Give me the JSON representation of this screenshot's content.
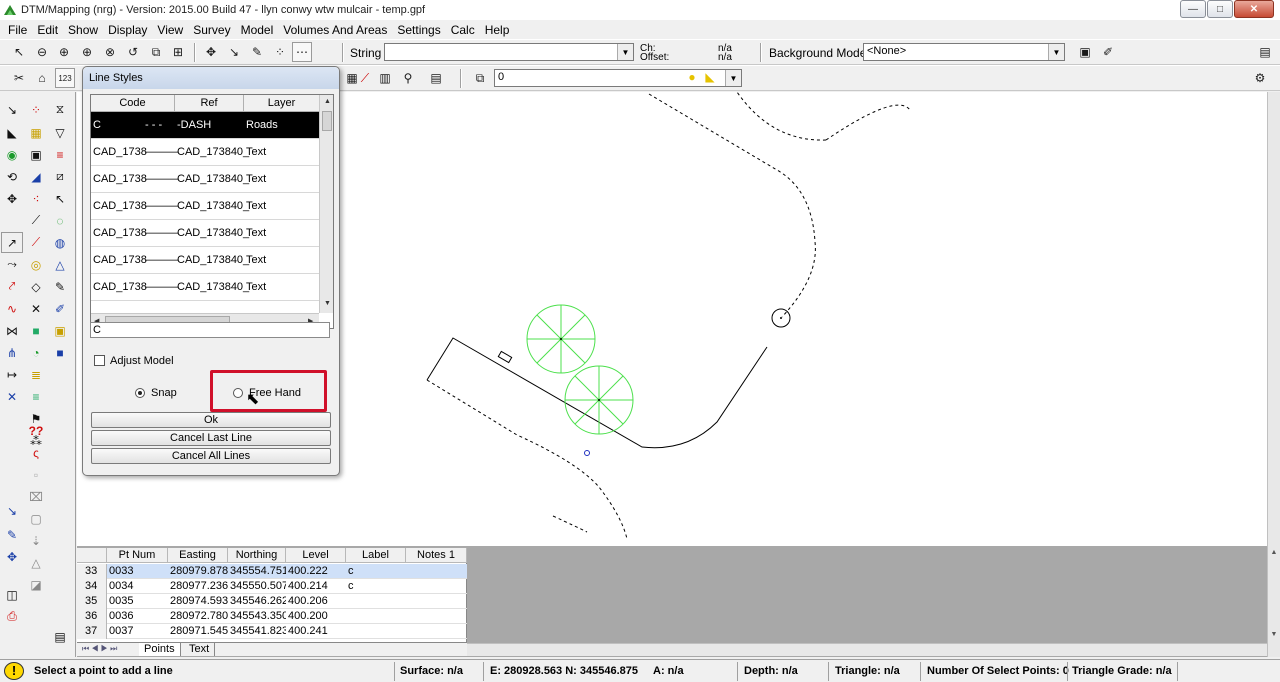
{
  "window": {
    "title": "DTM/Mapping (nrg) - Version: 2015.00 Build 47 - llyn conwy wtw mulcair - temp.gpf",
    "minimize": "—",
    "maximize": "□",
    "close": "✕"
  },
  "menu": [
    "File",
    "Edit",
    "Show",
    "Display",
    "View",
    "Survey",
    "Model",
    "Volumes And Areas",
    "Settings",
    "Calc",
    "Help"
  ],
  "toolbar": {
    "string_label": "String",
    "string_value": "",
    "ch_label": "Ch:",
    "offset_label": "Offset:",
    "ch_value": "n/a",
    "offset_value": "n/a",
    "background_model_label": "Background Model:",
    "background_model_value": "<None>",
    "layer_value": "0"
  },
  "dialog": {
    "title": "Line Styles",
    "columns": [
      "Code",
      "Ref",
      "Layer"
    ],
    "rows": [
      {
        "code": "C",
        "sample": "- - -",
        "ref": "-DASH",
        "layer": "Roads",
        "selected": true
      },
      {
        "code": "CAD_1738",
        "sample": "———",
        "ref": "CAD_173840_",
        "layer": "Text"
      },
      {
        "code": "CAD_1738",
        "sample": "———",
        "ref": "CAD_173840_",
        "layer": "Text"
      },
      {
        "code": "CAD_1738",
        "sample": "———",
        "ref": "CAD_173840_",
        "layer": "Text"
      },
      {
        "code": "CAD_1738",
        "sample": "———",
        "ref": "CAD_173840_",
        "layer": "Text"
      },
      {
        "code": "CAD_1738",
        "sample": "———",
        "ref": "CAD_173840_",
        "layer": "Text"
      },
      {
        "code": "CAD_1738",
        "sample": "———",
        "ref": "CAD_173840_",
        "layer": "Text"
      }
    ],
    "code_value": "C",
    "adjust_model_label": "Adjust Model",
    "snap_label": "Snap",
    "free_hand_label": "Free Hand",
    "ok_label": "Ok",
    "cancel_last_label": "Cancel Last Line",
    "cancel_all_label": "Cancel All Lines"
  },
  "grid": {
    "columns": [
      "Pt Num",
      "Easting",
      "Northing",
      "Level",
      "Label",
      "Notes 1"
    ],
    "rows": [
      {
        "idx": "33",
        "pt": "0033",
        "e": "280979.878",
        "n": "345554.751",
        "lvl": "400.222",
        "label": "c",
        "notes": ""
      },
      {
        "idx": "34",
        "pt": "0034",
        "e": "280977.236",
        "n": "345550.507",
        "lvl": "400.214",
        "label": "c",
        "notes": ""
      },
      {
        "idx": "35",
        "pt": "0035",
        "e": "280974.593",
        "n": "345546.262",
        "lvl": "400.206",
        "label": "",
        "notes": ""
      },
      {
        "idx": "36",
        "pt": "0036",
        "e": "280972.780",
        "n": "345543.350",
        "lvl": "400.200",
        "label": "",
        "notes": ""
      },
      {
        "idx": "37",
        "pt": "0037",
        "e": "280971.545",
        "n": "345541.823",
        "lvl": "400.241",
        "label": "",
        "notes": ""
      }
    ],
    "tabs": [
      "Points",
      "Text"
    ]
  },
  "status": {
    "icon": "!",
    "message": "Select a point to add a line",
    "surface": "Surface: n/a",
    "en": "E: 280928.563  N: 345546.875",
    "a": "A: n/a",
    "depth": "Depth: n/a",
    "triangle": "Triangle: n/a",
    "select_points": "Number Of Select Points: 0",
    "triangle_grade": "Triangle Grade: n/a"
  },
  "colors": {
    "tree_green": "#4ce04c",
    "highlight_red": "#d0102a",
    "selection_black": "#000000",
    "marker_blue": "#2030c0"
  }
}
